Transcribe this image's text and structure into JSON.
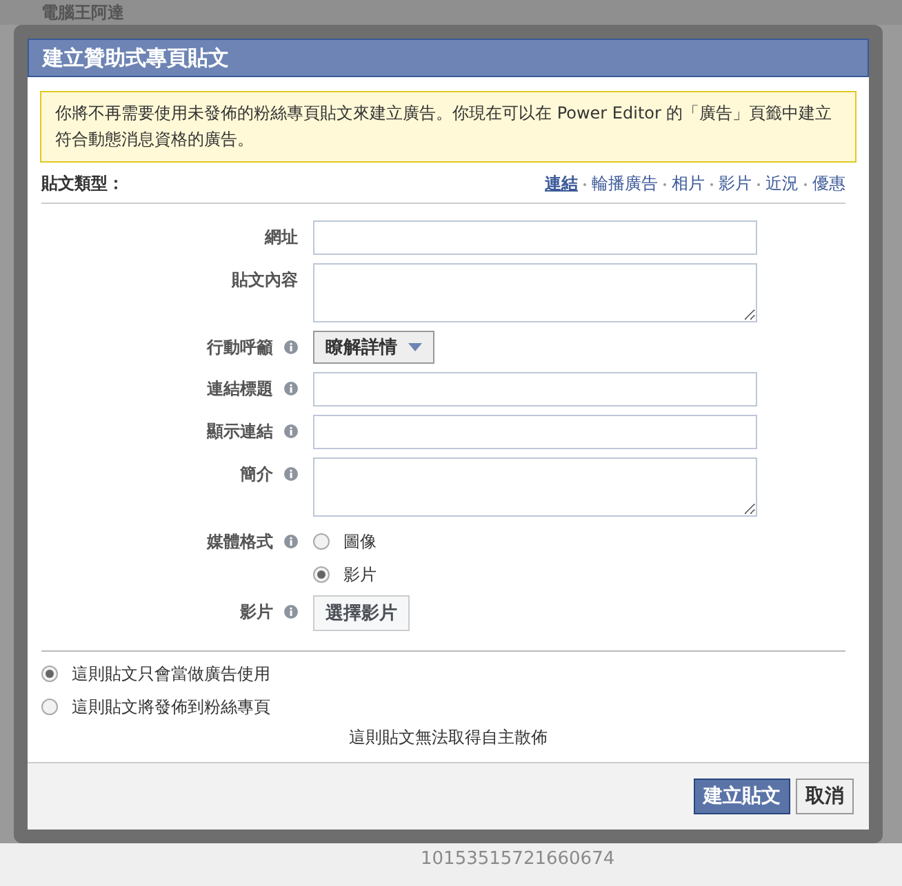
{
  "background": {
    "page_selector": "電腦王阿達",
    "post_id": "10153515721660674"
  },
  "dialog": {
    "title": "建立贊助式專頁貼文",
    "notice": "你將不再需要使用未發佈的粉絲專頁貼文來建立廣告。你現在可以在 Power Editor 的「廣告」頁籤中建立符合動態消息資格的廣告。",
    "post_type": {
      "label": "貼文類型：",
      "options": [
        {
          "label": "連結",
          "selected": true
        },
        {
          "label": "輪播廣告",
          "selected": false
        },
        {
          "label": "相片",
          "selected": false
        },
        {
          "label": "影片",
          "selected": false
        },
        {
          "label": "近況",
          "selected": false
        },
        {
          "label": "優惠",
          "selected": false
        }
      ]
    },
    "fields": [
      {
        "kind": "text",
        "label": "網址",
        "info": false
      },
      {
        "kind": "textarea",
        "label": "貼文內容",
        "info": false
      },
      {
        "kind": "dropdown",
        "label": "行動呼籲",
        "info": true,
        "value": "瞭解詳情"
      },
      {
        "kind": "text",
        "label": "連結標題",
        "info": true
      },
      {
        "kind": "text",
        "label": "顯示連結",
        "info": true
      },
      {
        "kind": "textarea",
        "label": "簡介",
        "info": true
      },
      {
        "kind": "radio",
        "label": "媒體格式",
        "info": true,
        "options": [
          {
            "label": "圖像",
            "selected": false
          },
          {
            "label": "影片",
            "selected": true
          }
        ]
      },
      {
        "kind": "button",
        "label": "影片",
        "info": true,
        "value": "選擇影片"
      }
    ],
    "audience": [
      {
        "label": "這則貼文只會當做廣告使用",
        "selected": true
      },
      {
        "label": "這則貼文將發佈到粉絲專頁",
        "selected": false
      }
    ],
    "note": "這則貼文無法取得自主散佈",
    "buttons": [
      {
        "label": "建立貼文",
        "kind": "primary"
      },
      {
        "label": "取消",
        "kind": "secondary"
      }
    ]
  }
}
